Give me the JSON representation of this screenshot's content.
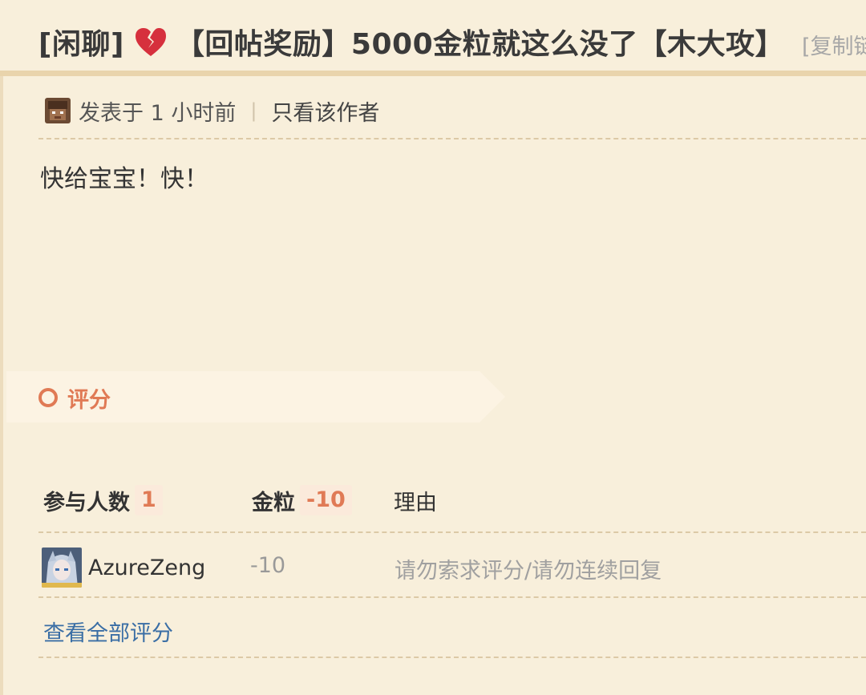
{
  "thread": {
    "category": "[闲聊]",
    "heart_icon": "broken-heart-icon",
    "title": "【回帖奖励】5000金粒就这么没了【木大攻】",
    "copy_link": "[复制链"
  },
  "meta": {
    "posted": "发表于 1 小时前",
    "separator": "|",
    "only_author": "只看该作者"
  },
  "post": {
    "content": "快给宝宝！快！"
  },
  "rating": {
    "title": "评分",
    "participants_label": "参与人数",
    "participants_count": "1",
    "gold_label": "金粒",
    "gold_total": "-10",
    "reason_label": "理由",
    "rows": [
      {
        "username": "AzureZeng",
        "score": "-10",
        "reason": "请勿索求评分/请勿连续回复"
      }
    ],
    "view_all": "查看全部评分"
  },
  "colors": {
    "background": "#f8efdb",
    "accent": "#e07a55",
    "link": "#3a6ea5",
    "rule": "#e9d4ac"
  }
}
